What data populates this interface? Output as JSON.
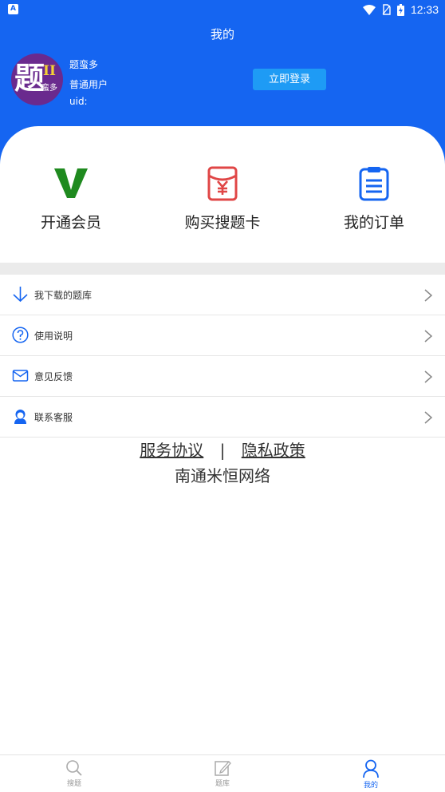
{
  "status_bar": {
    "left_badge": "A",
    "time": "12:33"
  },
  "header": {
    "title": "我的"
  },
  "user": {
    "avatar_text_main": "题",
    "avatar_text_side": "II",
    "avatar_text_sub": "蛮多",
    "name": "题蛮多",
    "type": "普通用户",
    "uid": "uid:",
    "login_label": "立即登录"
  },
  "actions": [
    {
      "label": "开通会员",
      "icon": "v-vip-icon",
      "color": "#1f8a1f"
    },
    {
      "label": "购买搜题卡",
      "icon": "yuan-card-icon",
      "color": "#e04646"
    },
    {
      "label": "我的订单",
      "icon": "order-list-icon",
      "color": "#1565f1"
    }
  ],
  "menu": [
    {
      "label": "我下载的题库",
      "icon": "download-icon"
    },
    {
      "label": "使用说明",
      "icon": "question-circle-icon"
    },
    {
      "label": "意见反馈",
      "icon": "mail-icon"
    },
    {
      "label": "联系客服",
      "icon": "customer-service-icon"
    }
  ],
  "footer": {
    "service_agreement": "服务协议",
    "separator": "|",
    "privacy_policy": "隐私政策",
    "company": "南通米恒网络"
  },
  "bottom_nav": [
    {
      "label": "搜题",
      "icon": "search-icon",
      "active": false
    },
    {
      "label": "题库",
      "icon": "edit-note-icon",
      "active": false
    },
    {
      "label": "我的",
      "icon": "user-icon",
      "active": true
    }
  ],
  "colors": {
    "primary": "#1565f1",
    "login_button": "#1e9bf5",
    "vip": "#1f8a1f",
    "card": "#e04646"
  }
}
